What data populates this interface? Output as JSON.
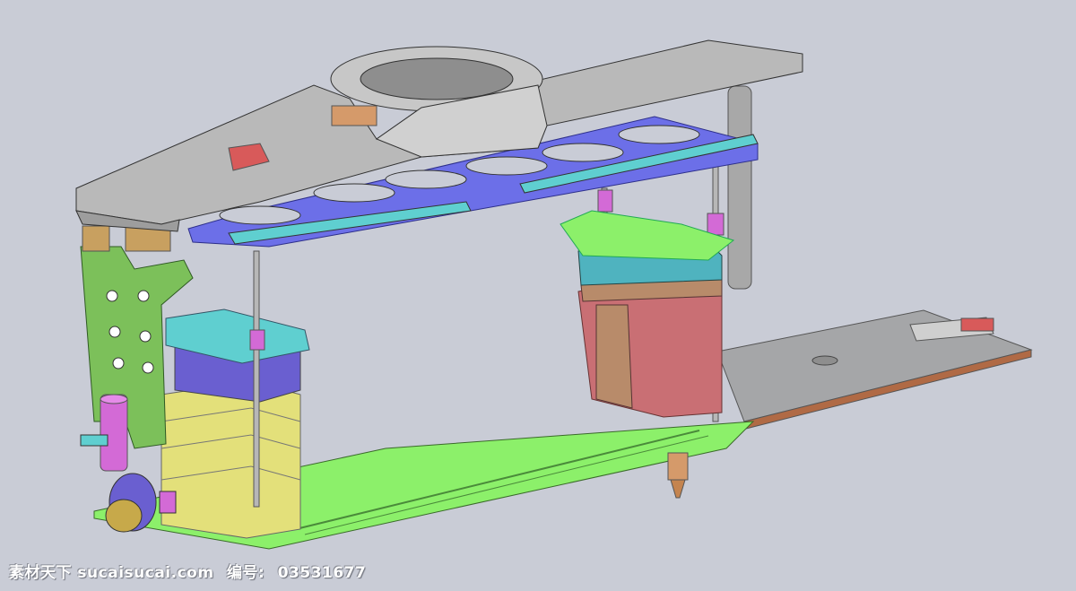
{
  "scene": {
    "background_color": "#c9ccd6",
    "colors": {
      "gray_arm": "#b9b9b9",
      "blue_plate": "#6c6fe8",
      "green_base": "#8cf06a",
      "green_bracket": "#7cc05a",
      "cyan_block": "#5fcfd0",
      "teal_block": "#4fb3bf",
      "yellow_block": "#e3e07a",
      "violet_block": "#6a5fd0",
      "red_block": "#c96f74",
      "tan_block": "#b88b6a",
      "magenta_part": "#d36ad6",
      "gold_wheel": "#c7a94a",
      "side_plate": "#a5a6a8",
      "rod": "#b7b7b7"
    }
  },
  "watermark": {
    "site": "素材天下 sucaisucai.com",
    "id_label": "编号:",
    "id_value": "03531677"
  }
}
